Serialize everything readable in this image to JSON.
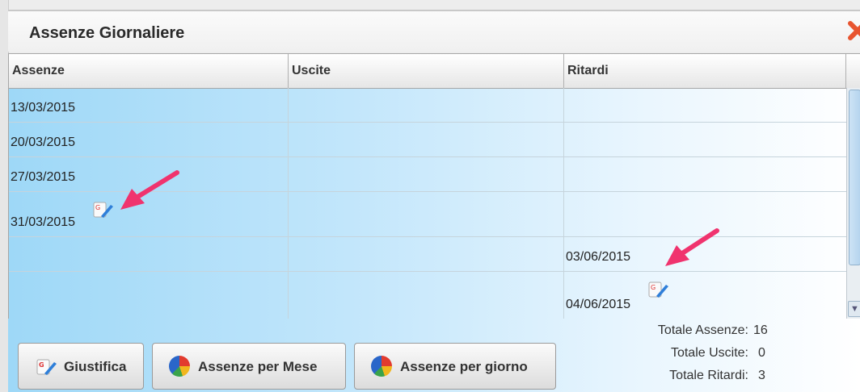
{
  "window": {
    "title": "Assenze Giornaliere",
    "close_icon": "close-icon"
  },
  "table": {
    "columns": [
      "Assenze",
      "Uscite",
      "Ritardi"
    ],
    "rows": [
      {
        "assenze": "13/03/2015",
        "uscite": "",
        "ritardi": ""
      },
      {
        "assenze": "20/03/2015",
        "uscite": "",
        "ritardi": ""
      },
      {
        "assenze": "27/03/2015",
        "uscite": "",
        "ritardi": ""
      },
      {
        "assenze": "31/03/2015",
        "uscite": "",
        "ritardi": ""
      },
      {
        "assenze": "",
        "uscite": "",
        "ritardi": "03/06/2015"
      },
      {
        "assenze": "",
        "uscite": "",
        "ritardi": "04/06/2015"
      }
    ]
  },
  "buttons": {
    "giustifica": "Giustifica",
    "per_mese": "Assenze per Mese",
    "per_giorno": "Assenze per giorno"
  },
  "totals": {
    "assenze_label": "Totale Assenze:",
    "assenze_value": "16",
    "uscite_label": "Totale Uscite:",
    "uscite_value": "0",
    "ritardi_label": "Totale Ritardi:",
    "ritardi_value": "3"
  },
  "colors": {
    "accent_arrow": "#f0336e",
    "close": "#e8542f",
    "row_gradient_start": "#9ed8f7"
  }
}
